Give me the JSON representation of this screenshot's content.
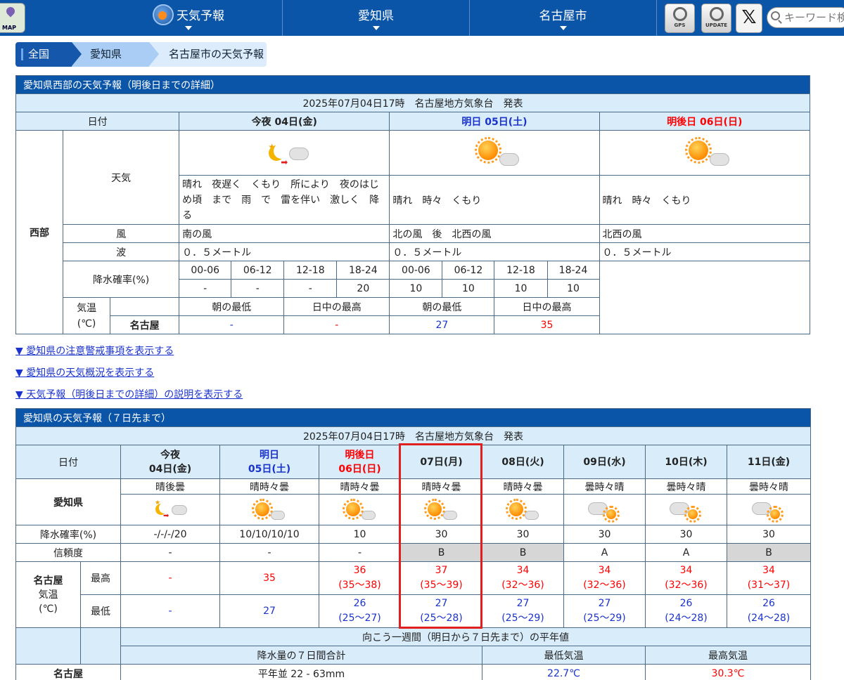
{
  "header": {
    "map_label": "MAP",
    "nav_weather": "天気予報",
    "nav_pref": "愛知県",
    "nav_city": "名古屋市",
    "gps_label": "GPS",
    "update_label": "UPDATE",
    "search_placeholder": "キーワード検索"
  },
  "breadcrumb": [
    "全国",
    "愛知県",
    "名古屋市の天気予報"
  ],
  "detail": {
    "caption": "愛知県西部の天気予報（明後日までの詳細）",
    "published": "2025年07月04日17時　名古屋地方気象台　発表",
    "date_label": "日付",
    "days": [
      {
        "label": "今夜 04日(金)",
        "tone": "normal"
      },
      {
        "label": "明日 05日(土)",
        "tone": "blue"
      },
      {
        "label": "明後日 06日(日)",
        "tone": "red"
      }
    ],
    "region": "西部",
    "weather_label": "天気",
    "weather_text": [
      "晴れ　夜遅く　くもり　所により　夜のはじめ頃　まで　雨　で　雷を伴い　激しく　降る",
      "晴れ　時々　くもり",
      "晴れ　時々　くもり"
    ],
    "wind_label": "風",
    "wind": [
      "南の風",
      "北の風　後　北西の風",
      "北西の風"
    ],
    "wave_label": "波",
    "wave": [
      "０．５メートル",
      "０．５メートル",
      "０．５メートル"
    ],
    "pop_label": "降水確率(%)",
    "pop_periods": [
      "00-06",
      "06-12",
      "12-18",
      "18-24",
      "00-06",
      "06-12",
      "12-18",
      "18-24"
    ],
    "pop_values": [
      "-",
      "-",
      "-",
      "20",
      "10",
      "10",
      "10",
      "10"
    ],
    "temp_label": "気温",
    "temp_unit": "(℃)",
    "temp_heads": [
      "朝の最低",
      "日中の最高",
      "朝の最低",
      "日中の最高"
    ],
    "temp_city": "名古屋",
    "temp_values": [
      "-",
      "-",
      "27",
      "35"
    ]
  },
  "links": [
    "▼ 愛知県の注意警戒事項を表示する",
    "▼ 愛知県の天気概況を表示する",
    "▼ 天気予報（明後日までの詳細）の説明を表示する"
  ],
  "week": {
    "caption": "愛知県の天気予報（７日先まで）",
    "published": "2025年07月04日17時　名古屋地方気象台　発表",
    "date_label": "日付",
    "days": [
      {
        "l1": "今夜",
        "l2": "04日(金)",
        "tone": "normal"
      },
      {
        "l1": "明日",
        "l2": "05日(土)",
        "tone": "blue"
      },
      {
        "l1": "明後日",
        "l2": "06日(日)",
        "tone": "red"
      },
      {
        "l1": "",
        "l2": "07日(月)",
        "tone": "normal"
      },
      {
        "l1": "",
        "l2": "08日(火)",
        "tone": "normal"
      },
      {
        "l1": "",
        "l2": "09日(水)",
        "tone": "normal"
      },
      {
        "l1": "",
        "l2": "10日(木)",
        "tone": "normal"
      },
      {
        "l1": "",
        "l2": "11日(金)",
        "tone": "normal"
      }
    ],
    "pref": "愛知県",
    "weather": [
      "晴後曇",
      "晴時々曇",
      "晴時々曇",
      "晴時々曇",
      "晴時々曇",
      "曇時々晴",
      "曇時々晴",
      "曇時々晴"
    ],
    "icons": [
      "moon-cloud",
      "sun-cloud",
      "sun-cloud",
      "sun-cloud",
      "sun-cloud",
      "cloud-sun",
      "cloud-sun",
      "cloud-sun"
    ],
    "pop_label": "降水確率(%)",
    "pop": [
      "-/-/-/20",
      "10/10/10/10",
      "10",
      "30",
      "30",
      "30",
      "30",
      "30"
    ],
    "rel_label": "信頼度",
    "rel": [
      "-",
      "-",
      "-",
      "B",
      "B",
      "A",
      "A",
      "B"
    ],
    "city": "名古屋",
    "temp_label": "気温",
    "temp_unit": "(℃)",
    "max_label": "最高",
    "min_label": "最低",
    "max": [
      "-",
      "35",
      "36",
      "37",
      "34",
      "34",
      "34",
      "34"
    ],
    "max_range": [
      "",
      "",
      "(35～38)",
      "(35～39)",
      "(32～36)",
      "(32～36)",
      "(32～36)",
      "(31～37)"
    ],
    "min": [
      "-",
      "27",
      "26",
      "27",
      "27",
      "27",
      "26",
      "26"
    ],
    "min_range": [
      "",
      "",
      "(25～27)",
      "(25～28)",
      "(25～29)",
      "(25～29)",
      "(24～28)",
      "(24～28)"
    ]
  },
  "normals": {
    "title": "向こう一週間（明日から７日先まで）の平年値",
    "heads": [
      "降水量の７日間合計",
      "最低気温",
      "最高気温"
    ],
    "city": "名古屋",
    "values": [
      "平年並 22 - 63mm",
      "22.7℃",
      "30.3℃"
    ]
  }
}
